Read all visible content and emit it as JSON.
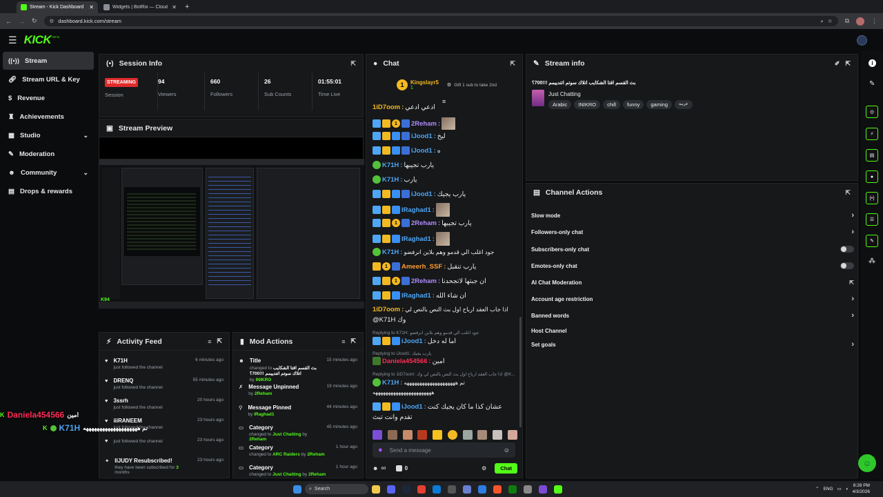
{
  "browser": {
    "tabs": [
      {
        "title": "Stream - Kick Dashboard",
        "active": true
      },
      {
        "title": "Widgets | BotRix — Cloud Strea",
        "active": false
      }
    ],
    "url": "dashboard.kick.com/stream"
  },
  "brand": {
    "logo": "KICK",
    "beta": "BETA",
    "accent": "#53fc18"
  },
  "sidebar": {
    "items": [
      {
        "label": "Stream",
        "icon": "broadcast-icon",
        "active": true
      },
      {
        "label": "Stream URL & Key",
        "icon": "link-icon"
      },
      {
        "label": "Revenue",
        "icon": "dollar-icon"
      },
      {
        "label": "Achievements",
        "icon": "trophy-icon"
      },
      {
        "label": "Studio",
        "icon": "studio-icon",
        "expandable": true
      },
      {
        "label": "Moderation",
        "icon": "wrench-icon"
      },
      {
        "label": "Community",
        "icon": "users-icon",
        "expandable": true
      },
      {
        "label": "Drops & rewards",
        "icon": "gift-icon"
      }
    ]
  },
  "session": {
    "title": "Session Info",
    "status": "STREAMING",
    "status_label": "Session",
    "viewers": "94",
    "viewers_label": "Viewers",
    "followers": "660",
    "followers_label": "Followers",
    "subs": "26",
    "subs_label": "Sub Counts",
    "time": "01:55:01",
    "time_label": "Time Live"
  },
  "preview": {
    "title": "Stream Preview"
  },
  "activity": {
    "title": "Activity Feed",
    "items": [
      {
        "name": "K71H",
        "desc": "just followed the channel",
        "time": "6 minutes ago"
      },
      {
        "name": "DRENQ",
        "desc": "just followed the channel",
        "time": "55 minutes ago"
      },
      {
        "name": "3ssrh",
        "desc": "just followed the channel",
        "time": "20 hours ago"
      },
      {
        "name": "iiiRANEEM",
        "desc": "just followed the channel",
        "time": "23 hours ago"
      },
      {
        "name": "",
        "desc": "just followed the channel",
        "time": "23 hours ago"
      },
      {
        "name": "",
        "desc": "just followed the channel",
        "time": "23 hours ago"
      },
      {
        "name": "IIJUDY Resubscribed!",
        "desc": "they have been subscribed for",
        "extra": "3",
        "extra2": "months",
        "time": "23 hours ago"
      }
    ]
  },
  "mod": {
    "title": "Mod Actions",
    "items": [
      {
        "title": "Title",
        "line1": "changed to",
        "line2": "بث القسم اقتا الشكايب اتلاك سوتم اتتدييمم !!!700؟",
        "by": "by",
        "who": "INIKRO",
        "time": "15 minutes ago"
      },
      {
        "title": "Message Unpinned",
        "by": "by",
        "who": "2Reham",
        "time": "19 minutes ago"
      },
      {
        "title": "Message Pinned",
        "by": "by",
        "who": "IRaghad1",
        "time": "44 minutes ago"
      },
      {
        "title": "Category",
        "line1": "changed to",
        "cat": "Just Chatting",
        "by": "by",
        "who": "2Reham",
        "time": "45 minutes ago"
      },
      {
        "title": "Category",
        "line1": "changed to",
        "cat": "ARC Raiders",
        "by": "by",
        "who": "2Reham",
        "time": "1 hour ago"
      },
      {
        "title": "Category",
        "line1": "changed to",
        "cat": "Just Chatting",
        "by": "by",
        "who": "2Reham",
        "time": "1 hour ago"
      }
    ]
  },
  "chat": {
    "title": "Chat",
    "top_gifter": "Kingslayr5",
    "top_gifter_count": "1",
    "gift_prompt": "Gift 1 sub to take 2nd",
    "pinned": {
      "user": "1iD7oom",
      "text": "ادعي ادعي"
    },
    "messages": [
      {
        "user": "2Reham",
        "text": "",
        "color": "u-purple"
      },
      {
        "user": "iJood1",
        "text": "ليخ",
        "color": "u-blue"
      },
      {
        "user": "iJood1",
        "text": "ه",
        "color": "u-blue"
      },
      {
        "user": "K71H",
        "text": "يارب تجيبها",
        "color": "u-blue"
      },
      {
        "user": "K71H",
        "text": "يارب",
        "color": "u-blue"
      },
      {
        "user": "iJood1",
        "text": "يارب يجيك",
        "color": "u-blue"
      },
      {
        "user": "IRaghad1",
        "text": "",
        "color": "u-blue"
      },
      {
        "user": "2Reham",
        "text": "يارب تجيبها",
        "color": "u-purple"
      },
      {
        "user": "IRaghad1",
        "text": "",
        "color": "u-blue"
      },
      {
        "user": "K71H",
        "text": "جود اغلب الي قدمو وهم بلاين انرفضو",
        "color": "u-blue"
      },
      {
        "user": "Ameerh_SSF",
        "text": "يارب تنقبل",
        "color": "u-orange"
      },
      {
        "user": "2Reham",
        "text": "ان جبتها لاتجحدنا",
        "color": "u-purple"
      },
      {
        "user": "IRaghad1",
        "text": "ان شاء الله",
        "color": "u-blue"
      },
      {
        "user": "1iD7oom",
        "text": "اذا جاب العقد ارباح اول بث النص بالنص لي",
        "text2": "@K71H وك",
        "color": "u-yellow"
      },
      {
        "user": "iJood1",
        "text": "اما له دخل",
        "color": "u-blue",
        "reply": "Replying to K71H: جود اغلب الي قدمو وهم بلاين انرفضو"
      },
      {
        "user": "Daniela454566",
        "text": "امين",
        "color": "u-red",
        "reply": "Replying to iJood1: يارب يجيك"
      },
      {
        "user": "K71H",
        "text": "تم ههههههههههههههههههههه",
        "text2": "هههههههههههههههههههههههه",
        "color": "u-blue",
        "reply": "Replying to 1iD7oom: اذا جاب العقد ارباح اول بث النص بالنص لي وك @K..."
      },
      {
        "user": "iJood1",
        "text": "عشان كذا ما كان يجيك كنت",
        "text2": "تقدم وانت تبث",
        "color": "u-blue"
      }
    ],
    "input_placeholder": "Send a message",
    "viewers_count": "∞",
    "points": "0",
    "send_label": "Chat"
  },
  "stream_info": {
    "title": "Stream info",
    "stream_title": "بث القسم اقتا الشكايب اتلاك سوتم اتتدييمم !!!700؟",
    "category": "Just Chatting",
    "tags": [
      "Arabic",
      "INIKRO",
      "chill",
      "funny",
      "gaming",
      "عربيه"
    ]
  },
  "channel_actions": {
    "title": "Channel Actions",
    "items": [
      {
        "label": "Slow mode",
        "kind": "arrow"
      },
      {
        "label": "Followers-only chat",
        "kind": "arrow"
      },
      {
        "label": "Subscribers-only chat",
        "kind": "toggle"
      },
      {
        "label": "Emotes-only chat",
        "kind": "toggle"
      },
      {
        "label": "AI Chat Moderation",
        "kind": "external"
      },
      {
        "label": "Account age restriction",
        "kind": "arrow"
      },
      {
        "label": "Banned words",
        "kind": "arrow"
      },
      {
        "label": "Host Channel",
        "kind": "none"
      },
      {
        "label": "Set goals",
        "kind": "arrow"
      }
    ]
  },
  "overlay": {
    "viewer_count": "94",
    "line1_user": "Daniela454566",
    "line1_text": "امين",
    "line2_user": "K71H",
    "line2_text": "تم ههههههههههههههههههههه"
  },
  "taskbar": {
    "search": "Search",
    "lang": "ENG",
    "time": "8:28 PM",
    "date": "4/3/2026"
  }
}
